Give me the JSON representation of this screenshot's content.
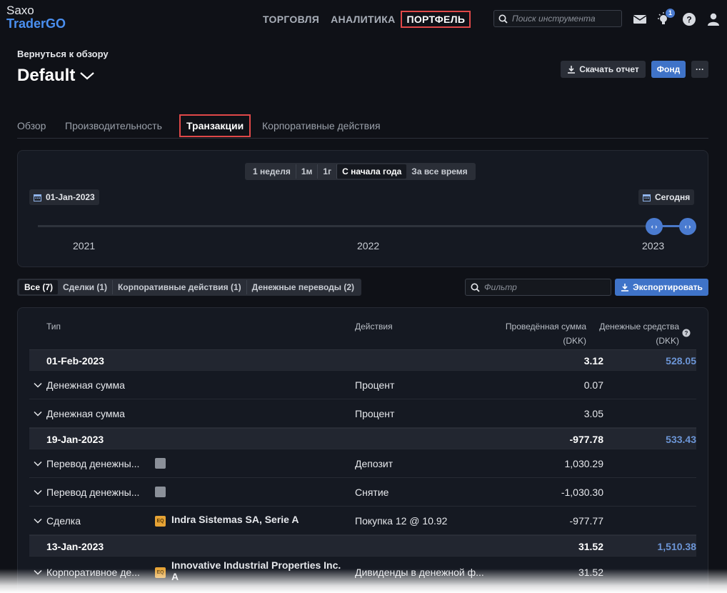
{
  "logo": {
    "line1": "Saxo",
    "line2": "TraderGO"
  },
  "nav": [
    {
      "label": "ТОРГОВЛЯ"
    },
    {
      "label": "АНАЛИТИКА"
    },
    {
      "label": "ПОРТФЕЛЬ",
      "active": true
    }
  ],
  "search": {
    "placeholder": "Поиск инструмента"
  },
  "notifications": {
    "count": "1"
  },
  "header": {
    "back_label": "Вернуться к обзору",
    "account_name": "Default",
    "download_label": "Скачать отчет",
    "fund_label": "Фонд",
    "more_label": "···"
  },
  "tabs": [
    {
      "label": "Обзор"
    },
    {
      "label": "Производительность"
    },
    {
      "label": "Транзакции",
      "active": true
    },
    {
      "label": "Корпоративные действия"
    }
  ],
  "timeline": {
    "periods": [
      "1 неделя",
      "1м",
      "1г",
      "С начала года",
      "За все время"
    ],
    "active_period": "С начала года",
    "start_date": "01-Jan-2023",
    "end_date": "Сегодня",
    "years": [
      "2021",
      "2022",
      "2023"
    ]
  },
  "filters": {
    "pills": [
      "Все (7)",
      "Сделки (1)",
      "Корпоративные действия (1)",
      "Денежные переводы (2)"
    ],
    "active": "Все (7)",
    "filter_placeholder": "Фильтр",
    "export_label": "Экспортировать"
  },
  "table": {
    "col_type": "Тип",
    "col_actions": "Действия",
    "col_amount_1": "Проведённая сумма",
    "col_amount_2": "(DKK)",
    "col_cash_1": "Денежные средства",
    "col_cash_2": "(DKK)",
    "groups": [
      {
        "date": "01-Feb-2023",
        "amount": "3.12",
        "cash": "528.05",
        "rows": [
          {
            "type": "Денежная сумма",
            "instrument": "",
            "icon": "",
            "action": "Процент",
            "amount": "0.07"
          },
          {
            "type": "Денежная сумма",
            "instrument": "",
            "icon": "",
            "action": "Процент",
            "amount": "3.05"
          }
        ]
      },
      {
        "date": "19-Jan-2023",
        "amount": "-977.78",
        "cash": "533.43",
        "rows": [
          {
            "type": "Перевод денежны...",
            "instrument": "",
            "icon": "doc-icon",
            "action": "Депозит",
            "amount": "1,030.29"
          },
          {
            "type": "Перевод денежны...",
            "instrument": "",
            "icon": "doc-icon",
            "action": "Снятие",
            "amount": "-1,030.30"
          },
          {
            "type": "Сделка",
            "instrument": "Indra Sistemas SA, Serie A",
            "icon": "eq-icon",
            "action": "Покупка 12 @ 10.92",
            "amount": "-977.77"
          }
        ]
      },
      {
        "date": "13-Jan-2023",
        "amount": "31.52",
        "cash": "1,510.38",
        "rows": [
          {
            "type": "Корпоративное де...",
            "instrument": "Innovative Industrial Properties Inc. A",
            "icon": "eq-icon",
            "action": "Дивиденды в денежной ф...",
            "amount": "31.52"
          }
        ]
      }
    ]
  },
  "colors": {
    "accent": "#4a7bd0",
    "highlight": "#e04848",
    "cash_link": "#6c95d6"
  }
}
